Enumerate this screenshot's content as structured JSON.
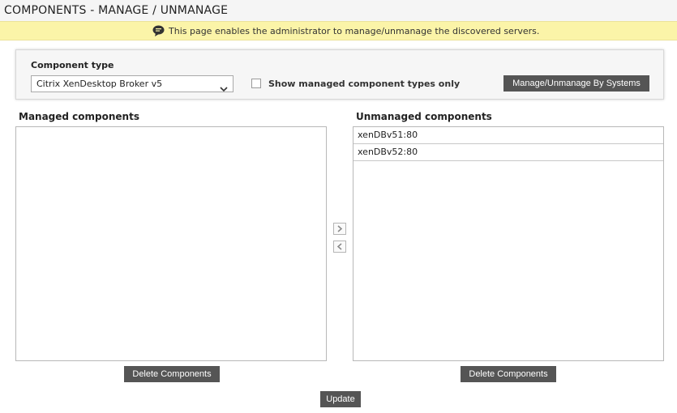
{
  "header": {
    "title": "COMPONENTS - MANAGE / UNMANAGE"
  },
  "info": {
    "icon": "speech-bubble-icon",
    "text": "This page enables the administrator to manage/unmanage the discovered servers."
  },
  "filter": {
    "component_type_label": "Component type",
    "component_type_value": "Citrix XenDesktop Broker v5",
    "show_managed_label": "Show managed component types only",
    "show_managed_checked": false,
    "manage_by_systems_label": "Manage/Unmanage By Systems"
  },
  "managed": {
    "title": "Managed components",
    "items": [],
    "delete_label": "Delete Components"
  },
  "unmanaged": {
    "title": "Unmanaged components",
    "items": [
      {
        "label": "xenDBv51:80"
      },
      {
        "label": "xenDBv52:80"
      }
    ],
    "delete_label": "Delete Components"
  },
  "move": {
    "right_icon": "chevron-right-icon",
    "left_icon": "chevron-left-icon"
  },
  "update_label": "Update",
  "colors": {
    "button": "#555555",
    "infobar": "#fbf4a8",
    "panel": "#f6f6f6"
  }
}
